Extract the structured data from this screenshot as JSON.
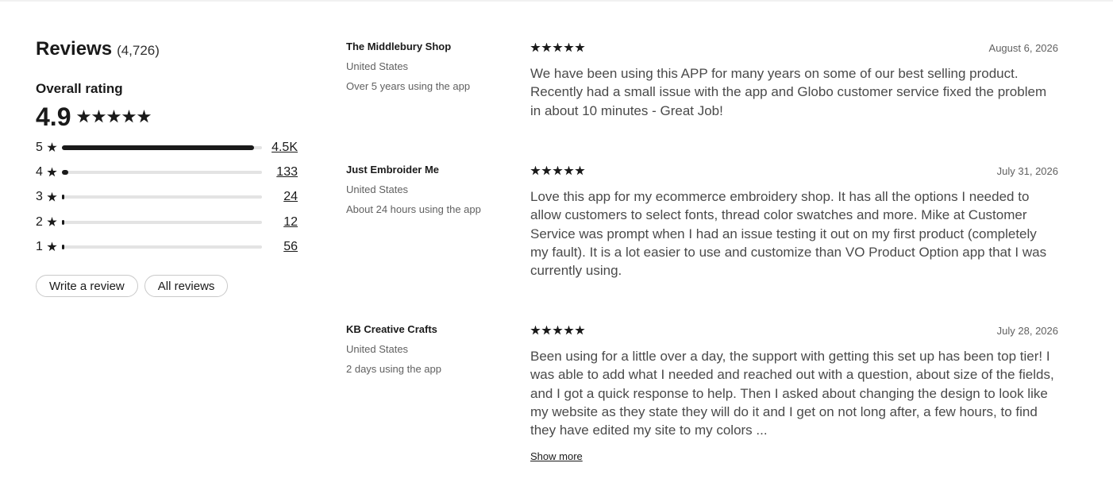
{
  "summary": {
    "title": "Reviews",
    "count": "(4,726)",
    "overall_label": "Overall rating",
    "overall_value": "4.9",
    "distribution": [
      {
        "stars": "5",
        "count": "4.5K",
        "fraction": 0.96
      },
      {
        "stars": "4",
        "count": "133",
        "fraction": 0.03
      },
      {
        "stars": "3",
        "count": "24",
        "fraction": 0.01
      },
      {
        "stars": "2",
        "count": "12",
        "fraction": 0.0
      },
      {
        "stars": "1",
        "count": "56",
        "fraction": 0.01
      }
    ],
    "write_review_label": "Write a review",
    "all_reviews_label": "All reviews"
  },
  "reviews": [
    {
      "shop": "The Middlebury Shop",
      "country": "United States",
      "usage": "Over 5 years using the app",
      "rating": 5,
      "date": "August 6, 2026",
      "text": "We have been using this APP for many years on some of our best selling product. Recently had a small issue with the app and Globo customer service fixed the problem in about 10 minutes - Great Job!"
    },
    {
      "shop": "Just Embroider Me",
      "country": "United States",
      "usage": "About 24 hours using the app",
      "rating": 5,
      "date": "July 31, 2026",
      "text": "Love this app for my ecommerce embroidery shop. It has all the options I needed to allow customers to select fonts, thread color swatches and more. Mike at Customer Service was prompt when I had an issue testing it out on my first product (completely my fault). It is a lot easier to use and customize than VO Product Option app that I was currently using."
    },
    {
      "shop": "KB Creative Crafts",
      "country": "United States",
      "usage": "2 days using the app",
      "rating": 5,
      "date": "July 28, 2026",
      "text": "Been using for a little over a day, the support with getting this set up has been top tier! I was able to add what I needed and reached out with a question, about size of the fields, and I got a quick response to help. Then I asked about changing the design to look like my website as they state they will do it and I get on not long after, a few hours, to find they have edited my site to my colors ...",
      "show_more": "Show more"
    }
  ]
}
